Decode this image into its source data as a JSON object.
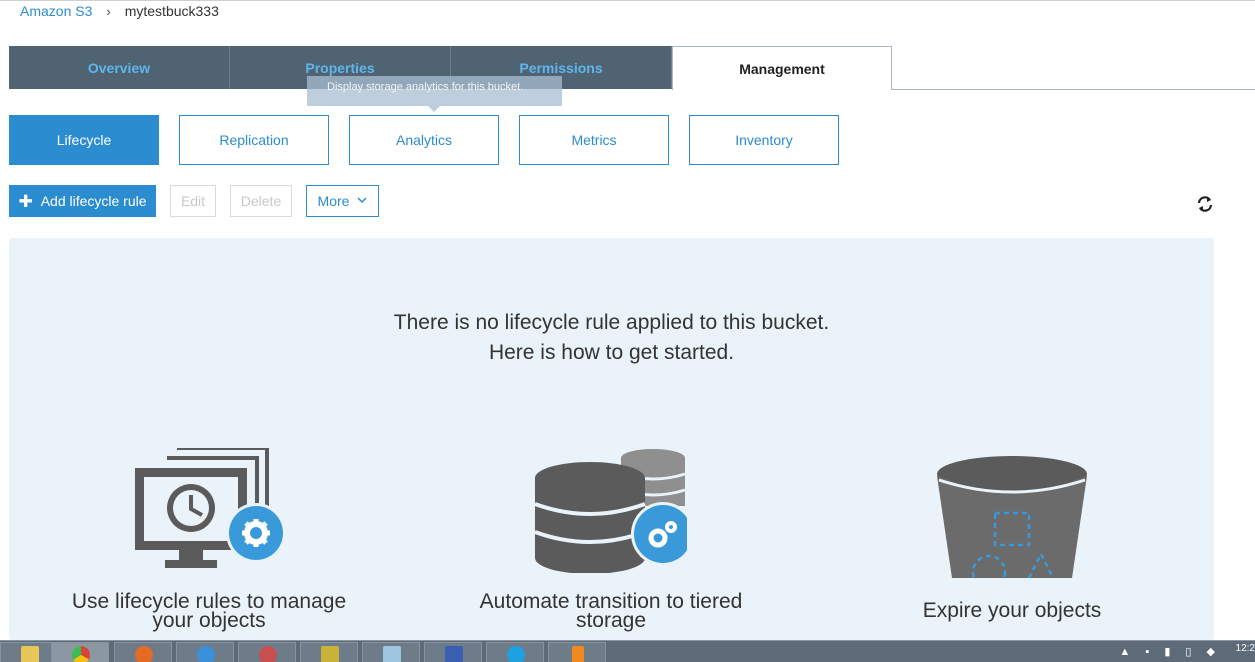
{
  "breadcrumb": {
    "root": "Amazon S3",
    "separator": "›",
    "current": "mytestbuck333"
  },
  "tabs": [
    {
      "label": "Overview"
    },
    {
      "label": "Properties"
    },
    {
      "label": "Permissions"
    },
    {
      "label": "Management"
    }
  ],
  "active_tab": "Management",
  "tooltip": "Display storage analytics for this bucket.",
  "subtabs": [
    {
      "label": "Lifecycle"
    },
    {
      "label": "Replication"
    },
    {
      "label": "Analytics"
    },
    {
      "label": "Metrics"
    },
    {
      "label": "Inventory"
    }
  ],
  "active_subtab": "Lifecycle",
  "toolbar": {
    "add_icon": "plus-icon",
    "add_label": "Add lifecycle rule",
    "edit_label": "Edit",
    "delete_label": "Delete",
    "more_label": "More",
    "more_icon": "chevron-down-icon",
    "refresh_icon": "refresh-icon"
  },
  "empty_state": {
    "line1": "There is no lifecycle rule applied to this bucket.",
    "line2": "Here is how to get started."
  },
  "features": [
    {
      "icon": "lifecycle-monitor-icon",
      "line1": "Use lifecycle rules to manage",
      "line2": "your objects"
    },
    {
      "icon": "tiered-storage-icon",
      "line1": "Automate transition to tiered",
      "line2": "storage"
    },
    {
      "icon": "expire-bucket-icon",
      "line1": "Expire your objects",
      "line2": ""
    }
  ],
  "taskbar": {
    "apps": [
      "explorer-icon",
      "chrome-icon",
      "firefox-icon",
      "ie-icon",
      "tool-icon",
      "keys-icon",
      "notepad-icon",
      "network-icon",
      "skype-icon",
      "vlc-icon"
    ],
    "clock": "12:2"
  },
  "colors": {
    "accent": "#2b8ccf",
    "tab_bg": "#4f6373",
    "panel_bg": "#eaf3fa",
    "icon_gray": "#5b5b5b"
  }
}
